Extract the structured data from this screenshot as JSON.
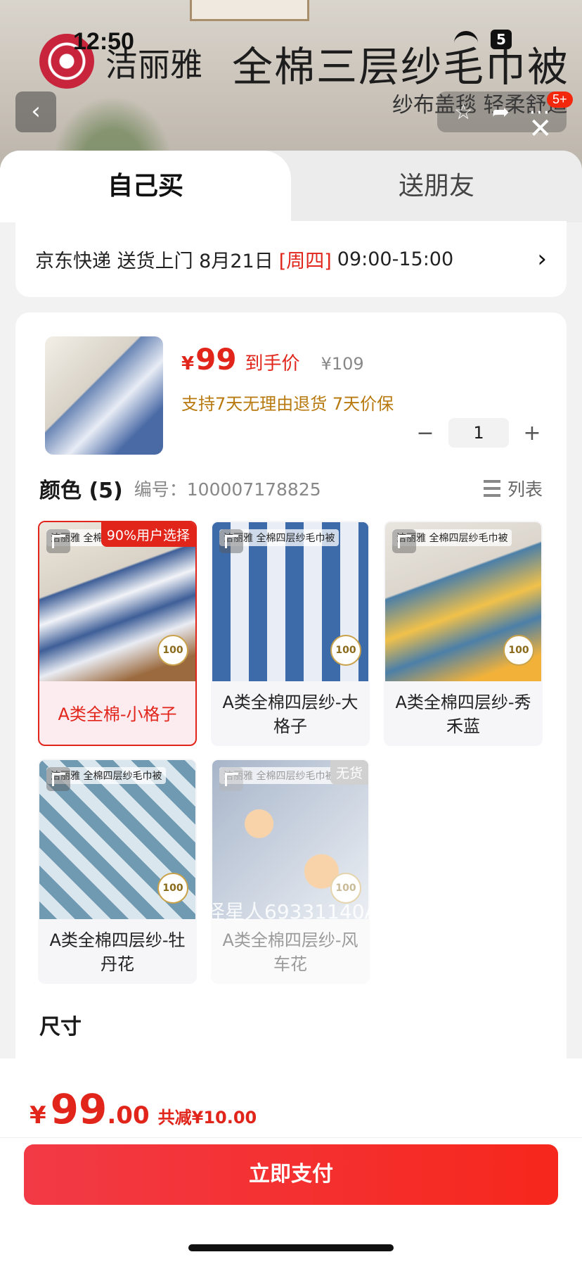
{
  "status_bar": {
    "time": "12:50",
    "battery": "5"
  },
  "background": {
    "brand": "洁丽雅",
    "title": "全棉三层纱毛巾被",
    "subtitle": "纱布盖毯 轻柔舒适",
    "badge": "5+"
  },
  "tabs": [
    {
      "label": "自己买"
    },
    {
      "label": "送朋友"
    }
  ],
  "delivery": {
    "prefix": "京东快递 送货上门 8月21日",
    "weekday": "[周四]",
    "window": "09:00-15:00"
  },
  "product": {
    "currency": "¥",
    "price": "99",
    "price_label": "到手价",
    "original_price": "¥109",
    "promise": "支持7天无理由退货   7天价保",
    "quantity": "1",
    "minus": "−",
    "plus": "+"
  },
  "color_section": {
    "title": "颜色 (5)",
    "code_label": "编号：",
    "code": "100007178825",
    "list_label": "列表",
    "options": [
      {
        "label": "A类全棉-小格子",
        "badge": "90%用户选择",
        "brand": "洁丽雅 全棉三层纱毛巾被",
        "cert": "100",
        "selected": true
      },
      {
        "label": "A类全棉四层纱-大格子",
        "badge": "",
        "brand": "洁丽雅 全棉四层纱毛巾被",
        "cert": "100"
      },
      {
        "label": "A类全棉四层纱-秀禾蓝",
        "badge": "",
        "brand": "洁丽雅 全棉四层纱毛巾被",
        "cert": "100"
      },
      {
        "label": "A类全棉四层纱-牡丹花",
        "badge": "",
        "brand": "洁丽雅 全棉四层纱毛巾被",
        "cert": "100"
      },
      {
        "label": "A类全棉四层纱-风车花",
        "badge": "无货",
        "brand": "洁丽雅 全棉四层纱毛巾被",
        "cert": "100",
        "disabled": true
      }
    ],
    "watermark": "怪星人69331140A"
  },
  "size_section": {
    "title": "尺寸"
  },
  "footer": {
    "currency": "¥",
    "total_int": "99",
    "total_dec": ".00",
    "saving": "共减¥10.00",
    "pay_label": "立即支付"
  },
  "colors": {
    "accent": "#e1251b",
    "promise": "#b8790f"
  }
}
